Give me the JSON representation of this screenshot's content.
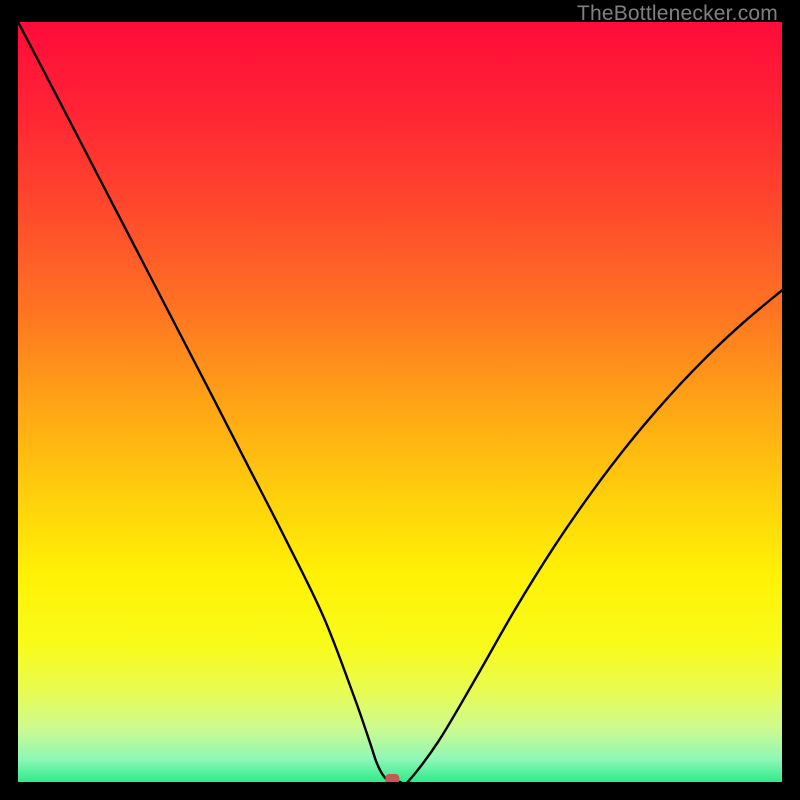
{
  "watermark": "TheBottlenecker.com",
  "chart_data": {
    "type": "line",
    "title": "",
    "xlabel": "",
    "ylabel": "",
    "xlim": [
      0,
      100
    ],
    "ylim": [
      0,
      100
    ],
    "x": [
      0,
      5,
      10,
      15,
      20,
      25,
      30,
      35,
      40,
      44,
      46,
      47,
      48,
      49,
      50,
      51,
      55,
      60,
      65,
      70,
      75,
      80,
      85,
      90,
      95,
      100
    ],
    "values": [
      100,
      90.4,
      80.7,
      71.0,
      61.3,
      51.6,
      41.8,
      32.0,
      21.7,
      11.2,
      5.4,
      2.4,
      0.6,
      0.0,
      0.0,
      0.0,
      5.3,
      13.8,
      22.6,
      30.7,
      38.0,
      44.6,
      50.5,
      55.8,
      60.5,
      64.7
    ],
    "min_point_x": 49,
    "gradient_stops": [
      {
        "offset": 0.0,
        "color": "#ff0b3a"
      },
      {
        "offset": 0.12,
        "color": "#ff2534"
      },
      {
        "offset": 0.25,
        "color": "#ff4a2c"
      },
      {
        "offset": 0.38,
        "color": "#ff7422"
      },
      {
        "offset": 0.5,
        "color": "#ffa316"
      },
      {
        "offset": 0.62,
        "color": "#ffce0c"
      },
      {
        "offset": 0.73,
        "color": "#fff205"
      },
      {
        "offset": 0.82,
        "color": "#f8fb1a"
      },
      {
        "offset": 0.88,
        "color": "#e9fb52"
      },
      {
        "offset": 0.93,
        "color": "#ccfb90"
      },
      {
        "offset": 0.97,
        "color": "#8ef7b6"
      },
      {
        "offset": 1.0,
        "color": "#2feb8a"
      }
    ],
    "marker": {
      "x_pct": 49,
      "y_pct": 0,
      "color": "#c05a54"
    }
  }
}
